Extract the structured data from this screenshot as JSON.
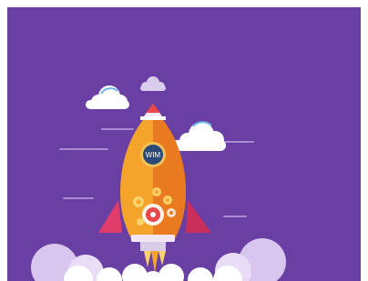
{
  "illustration": {
    "badge_text": "WIM",
    "colors": {
      "background": "#6a3fa4",
      "rocket_body": "#f4a42a",
      "rocket_shade": "#ea7a1f",
      "rocket_nose": "#e8474c",
      "rocket_fins": "#e23d6a",
      "badge": "#2c4a78",
      "cloud": "#ffffff",
      "smoke": "#d8c6ee"
    }
  }
}
